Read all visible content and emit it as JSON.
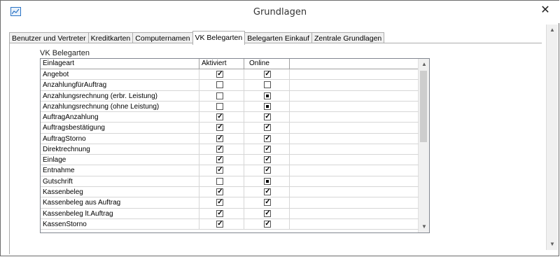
{
  "window": {
    "title": "Grundlagen",
    "close_label": "✕"
  },
  "tabs": [
    {
      "label": "Benutzer und Vertreter",
      "active": false
    },
    {
      "label": "Kreditkarten",
      "active": false
    },
    {
      "label": "Computernamen",
      "active": false
    },
    {
      "label": "VK Belegarten",
      "active": true
    },
    {
      "label": "Belegarten Einkauf",
      "active": false
    },
    {
      "label": "Zentrale Grundlagen",
      "active": false
    }
  ],
  "panel": {
    "group_label": "VK Belegarten",
    "columns": {
      "name": "Einlageart",
      "aktiviert": "Aktiviert",
      "online": "Online"
    },
    "rows": [
      {
        "name": "Angebot",
        "aktiviert": "checked",
        "online": "checked"
      },
      {
        "name": "AnzahlungfürAuftrag",
        "aktiviert": "unchecked",
        "online": "unchecked"
      },
      {
        "name": "Anzahlungsrechnung (erbr. Leistung)",
        "aktiviert": "unchecked",
        "online": "indeterminate"
      },
      {
        "name": "Anzahlungsrechnung (ohne Leistung)",
        "aktiviert": "unchecked",
        "online": "indeterminate"
      },
      {
        "name": "AuftragAnzahlung",
        "aktiviert": "checked",
        "online": "checked"
      },
      {
        "name": "Auftragsbestätigung",
        "aktiviert": "checked",
        "online": "checked"
      },
      {
        "name": "AuftragStorno",
        "aktiviert": "checked",
        "online": "checked"
      },
      {
        "name": "Direktrechnung",
        "aktiviert": "checked",
        "online": "checked"
      },
      {
        "name": "Einlage",
        "aktiviert": "checked",
        "online": "checked"
      },
      {
        "name": "Entnahme",
        "aktiviert": "checked",
        "online": "checked"
      },
      {
        "name": "Gutschrift",
        "aktiviert": "unchecked",
        "online": "indeterminate"
      },
      {
        "name": "Kassenbeleg",
        "aktiviert": "checked",
        "online": "checked"
      },
      {
        "name": "Kassenbeleg aus Auftrag",
        "aktiviert": "checked",
        "online": "checked"
      },
      {
        "name": "Kassenbeleg lt.Auftrag",
        "aktiviert": "checked",
        "online": "checked"
      },
      {
        "name": "KassenStorno",
        "aktiviert": "checked",
        "online": "checked"
      }
    ]
  },
  "icons": {
    "app": "chart-icon",
    "close": "close-icon",
    "scroll_up": "scroll-up-arrow",
    "scroll_down": "scroll-down-arrow"
  }
}
